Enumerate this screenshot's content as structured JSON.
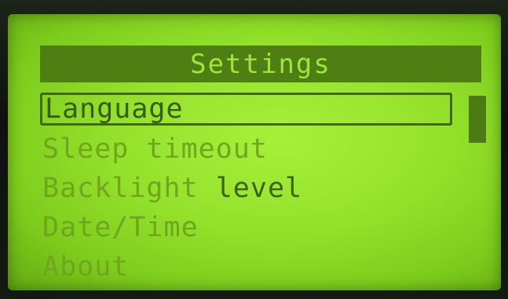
{
  "header": {
    "title": "Settings"
  },
  "menu": {
    "items": [
      {
        "label": "Language",
        "selected": true
      },
      {
        "label": "Sleep timeout",
        "selected": false
      },
      {
        "label_part1": "Backlight",
        "label_part2": "level",
        "selected": false
      },
      {
        "label": "Date/Time",
        "selected": false
      },
      {
        "label": "About",
        "selected": false
      }
    ]
  },
  "scrollbar": {
    "position_fraction": 0,
    "visible_fraction": 0.25
  },
  "colors": {
    "lcd_background": "#93e02a",
    "pixel_dark": "#3a6408",
    "pixel_dim": "#6fa51f",
    "title_bar": "#4f7e12"
  }
}
